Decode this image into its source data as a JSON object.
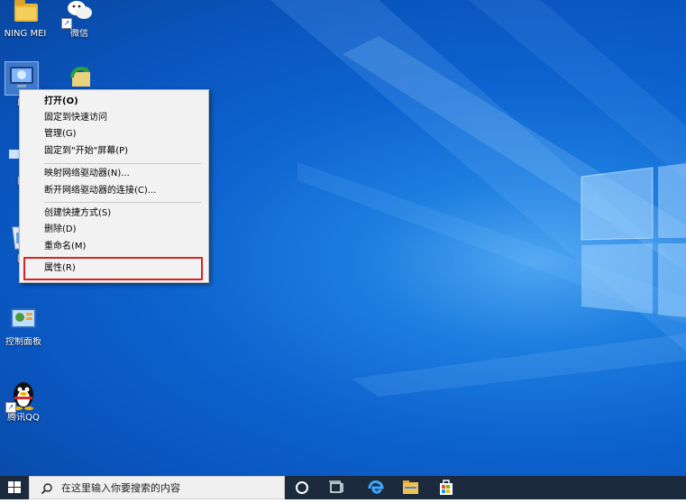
{
  "desktop": {
    "icons": [
      {
        "name": "ning-mei",
        "label": "NING MEI"
      },
      {
        "name": "wechat",
        "label": "微信"
      },
      {
        "name": "this-pc",
        "label": "此"
      },
      {
        "name": "network",
        "label": "网"
      },
      {
        "name": "recycle-bin",
        "label": "回"
      },
      {
        "name": "control-panel",
        "label": "控制面板"
      },
      {
        "name": "tencent-qq",
        "label": "腾讯QQ"
      }
    ]
  },
  "context_menu": {
    "items": [
      {
        "label": "打开(O)",
        "bold": true
      },
      {
        "label": "固定到快速访问"
      },
      {
        "label": "管理(G)"
      },
      {
        "label": "固定到\"开始\"屏幕(P)"
      },
      {
        "label": "映射网络驱动器(N)..."
      },
      {
        "label": "断开网络驱动器的连接(C)..."
      },
      {
        "label": "创建快捷方式(S)"
      },
      {
        "label": "删除(D)"
      },
      {
        "label": "重命名(M)"
      },
      {
        "label": "属性(R)",
        "highlighted": true
      }
    ],
    "highlight_color": "#e02020"
  },
  "taskbar": {
    "search_placeholder": "在这里输入你要搜索的内容",
    "icons": [
      "windows-start-icon",
      "search-icon",
      "cortana-icon",
      "task-view-icon",
      "edge-icon",
      "file-explorer-icon",
      "store-icon"
    ]
  }
}
